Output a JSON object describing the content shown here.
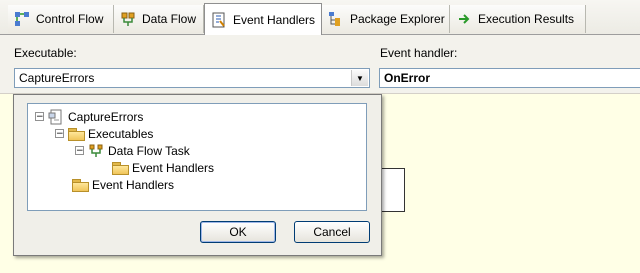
{
  "tabs": [
    {
      "label": "Control Flow",
      "icon": "control-flow-icon",
      "active": false
    },
    {
      "label": "Data Flow",
      "icon": "data-flow-icon",
      "active": false
    },
    {
      "label": "Event Handlers",
      "icon": "event-handlers-icon",
      "active": true
    },
    {
      "label": "Package Explorer",
      "icon": "package-explorer-icon",
      "active": false
    },
    {
      "label": "Execution Results",
      "icon": "execution-results-icon",
      "active": false
    }
  ],
  "executable": {
    "label": "Executable:",
    "value": "CaptureErrors"
  },
  "event_handler": {
    "label": "Event handler:",
    "value": "OnError"
  },
  "tree": {
    "root": "CaptureErrors",
    "executables": "Executables",
    "task": "Data Flow Task",
    "task_handlers": "Event Handlers",
    "root_handlers": "Event Handlers"
  },
  "buttons": {
    "ok": "OK",
    "cancel": "Cancel"
  },
  "colors": {
    "accent": "#003c74",
    "background": "#ffffe6"
  }
}
